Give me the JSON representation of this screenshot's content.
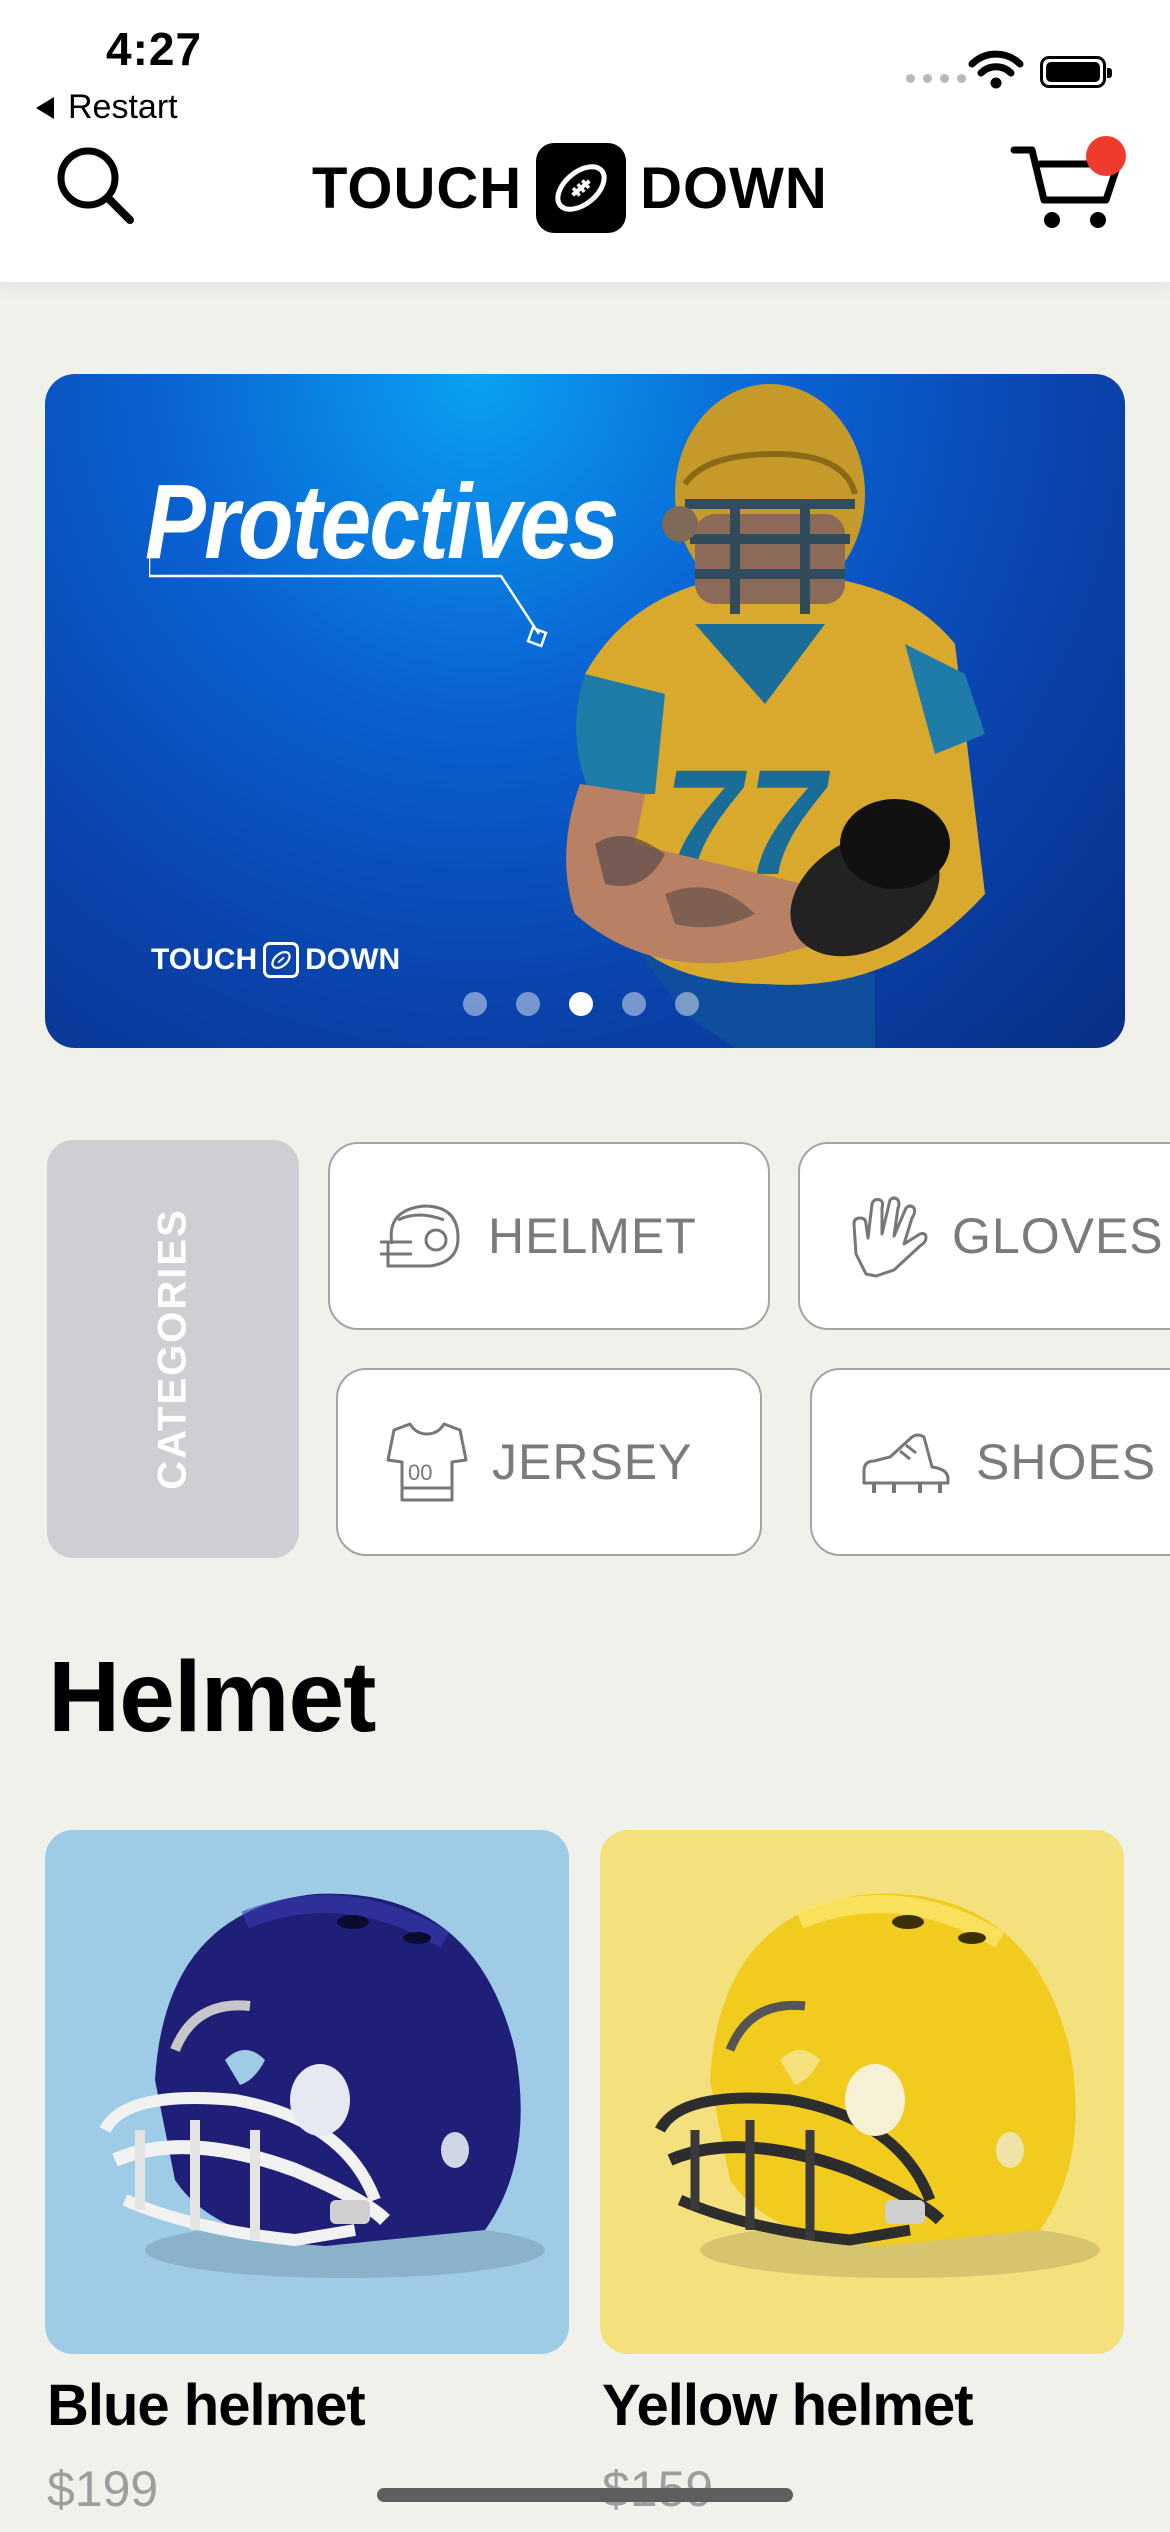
{
  "status_bar": {
    "time": "4:27",
    "back_label": "Restart"
  },
  "header": {
    "logo_left": "TOUCH",
    "logo_right": "DOWN",
    "cart_badge_color": "#ef3b2c",
    "icons": [
      "search-icon",
      "football-logo-icon",
      "cart-icon"
    ]
  },
  "banner": {
    "title": "Protectives",
    "brand_left": "TOUCH",
    "brand_right": "DOWN",
    "active_slide": 3,
    "slides": 5,
    "colors": {
      "top": "#0aa2f2",
      "bottom": "#082f86"
    }
  },
  "categories": {
    "tab_label": "CATEGORIES",
    "items": [
      {
        "label": "HELMET",
        "icon": "helmet-icon"
      },
      {
        "label": "GLOVES",
        "icon": "glove-icon"
      },
      {
        "label": "JERSEY",
        "icon": "jersey-icon"
      },
      {
        "label": "SHOES",
        "icon": "shoe-icon"
      }
    ]
  },
  "section": {
    "title": "Helmet",
    "products": [
      {
        "name": "Blue helmet",
        "price": "$199",
        "bg": "#9ecbe6",
        "shell": "#1f1f78"
      },
      {
        "name": "Yellow helmet",
        "price": "$159",
        "bg": "#f5e07e",
        "shell": "#f1cc1e"
      }
    ]
  }
}
